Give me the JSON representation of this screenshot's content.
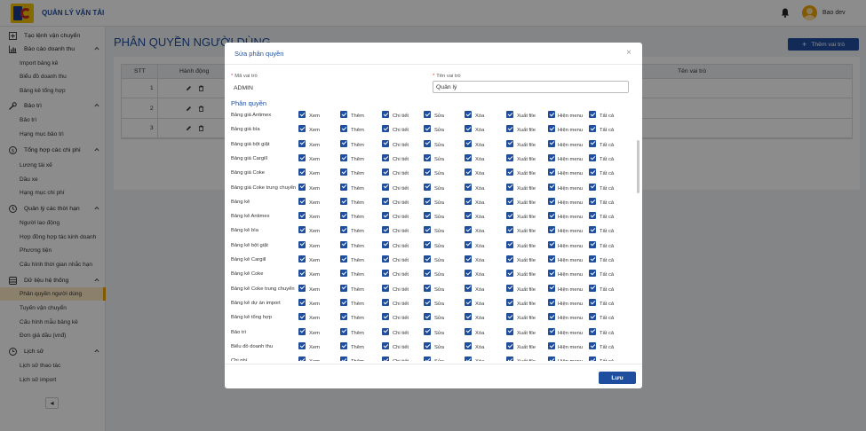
{
  "header": {
    "app_title": "QUẢN LÝ VẬN TẢI",
    "user_name": "Bao dev"
  },
  "sidebar": {
    "rows": [
      {
        "type": "group",
        "label": "Tạo lệnh vận chuyển",
        "icon": "plus-square-icon",
        "chevron": ""
      },
      {
        "type": "group",
        "label": "Báo cáo doanh thu",
        "icon": "bar-chart-icon",
        "chevron": "^"
      },
      {
        "type": "item",
        "label": "Import bảng kê"
      },
      {
        "type": "item",
        "label": "Biểu đồ doanh thu"
      },
      {
        "type": "item",
        "label": "Bảng kê tổng hợp"
      },
      {
        "type": "group",
        "label": "Bảo trì",
        "icon": "wrench-icon",
        "chevron": "^"
      },
      {
        "type": "item",
        "label": "Bảo trì"
      },
      {
        "type": "item",
        "label": "Hạng mục bảo trì"
      },
      {
        "type": "group",
        "label": "Tổng hợp các chi phí",
        "icon": "dollar-icon",
        "chevron": "^"
      },
      {
        "type": "item",
        "label": "Lương tài xế"
      },
      {
        "type": "item",
        "label": "Dầu xe"
      },
      {
        "type": "item",
        "label": "Hạng mục chi phí"
      },
      {
        "type": "group",
        "label": "Quản lý các thời hạn",
        "icon": "clock-icon",
        "chevron": "^"
      },
      {
        "type": "item",
        "label": "Người lao động"
      },
      {
        "type": "item",
        "label": "Hợp đồng hợp tác kinh doanh"
      },
      {
        "type": "item",
        "label": "Phương tiện"
      },
      {
        "type": "item",
        "label": "Cấu hình thời gian nhắc hạn"
      },
      {
        "type": "group",
        "label": "Dữ liệu hệ thống",
        "icon": "database-icon",
        "chevron": "^"
      },
      {
        "type": "item",
        "label": "Phân quyền người dùng",
        "active": true
      },
      {
        "type": "item",
        "label": "Tuyến vận chuyển"
      },
      {
        "type": "item",
        "label": "Cấu hình mẫu bảng kê"
      },
      {
        "type": "item",
        "label": "Đơn giá dầu (vnđ)"
      },
      {
        "type": "group",
        "label": "Lịch sử",
        "icon": "history-icon",
        "chevron": "^"
      },
      {
        "type": "item",
        "label": "Lịch sử thao tác"
      },
      {
        "type": "item",
        "label": "Lịch sử import"
      }
    ],
    "collapse_glyph": "◂"
  },
  "page": {
    "title": "PHÂN QUYỀN NGƯỜI DÙNG",
    "add_button": "Thêm vai trò",
    "table": {
      "headers": {
        "stt": "STT",
        "actions": "Hành động",
        "role_name": "Tên vai trò"
      },
      "rows": [
        "1",
        "2",
        "3"
      ]
    }
  },
  "modal": {
    "title": "Sửa phân quyền",
    "close_glyph": "×",
    "role_code_label": "Mã vai trò",
    "role_code_value": "ADMIN",
    "role_name_label": "Tên vai trò",
    "role_name_value": "Quản lý",
    "section_title": "Phân quyền",
    "permission_columns": [
      "Xem",
      "Thêm",
      "Chi tiết",
      "Sửa",
      "Xóa",
      "Xuất file",
      "Hiện menu",
      "Tất cả"
    ],
    "permission_rows": [
      "Bảng giá Antimex",
      "Bảng giá bìa",
      "Bảng giá bột giặt",
      "Bảng giá Cargill",
      "Bảng giá Coke",
      "Bảng giá Coke trung chuyển",
      "Bảng kê",
      "Bảng kê Antimex",
      "Bảng kê bìa",
      "Bảng kê bột giặt",
      "Bảng kê Cargill",
      "Bảng kê Coke",
      "Bảng kê Coke trung chuyển",
      "Bảng kê dự án import",
      "Bảng kê tổng hợp",
      "Bảo trì",
      "Biểu đồ doanh thu",
      "Chi phí"
    ],
    "save_button": "Lưu"
  },
  "colors": {
    "primary": "#1f4e9e",
    "accent": "#f0a500",
    "active_bg": "#fdeac4"
  }
}
